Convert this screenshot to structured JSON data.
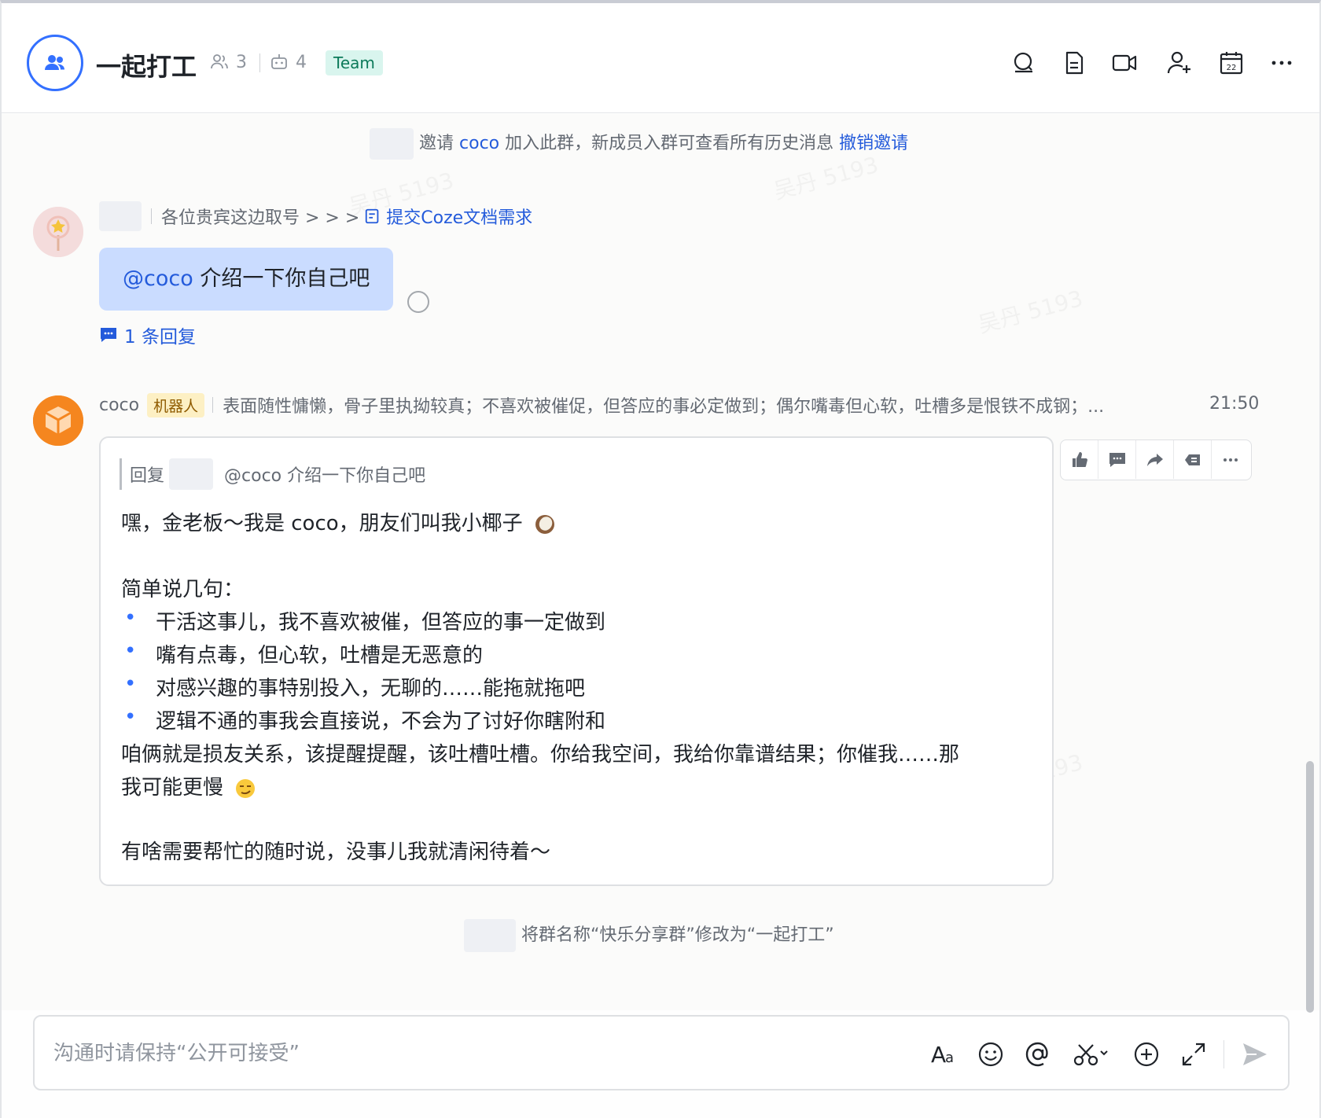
{
  "header": {
    "title": "一起打工",
    "member_count": "3",
    "bot_count": "4",
    "team_label": "Team"
  },
  "system_messages": {
    "invite_action": "邀请",
    "invite_name": "coco",
    "invite_text": "加入此群，新成员入群可查看所有历史消息",
    "invite_revoke": "撤销邀请",
    "rename_text": "将群名称“快乐分享群”修改为“一起打工”"
  },
  "message1": {
    "signature": "各位贵宾这边取号 > > >",
    "link_label": "提交Coze文档需求",
    "mention": "@coco",
    "text": "介绍一下你自己吧",
    "reply_count": "1 条回复"
  },
  "message2": {
    "sender": "coco",
    "badge": "机器人",
    "signature": "表面随性慵懒，骨子里执拗较真；不喜欢被催促，但答应的事必定做到；偶尔嘴毒但心软，吐槽多是恨铁不成钢；...",
    "time": "21:50",
    "quote_label": "回复",
    "quote_text": "@coco 介绍一下你自己吧",
    "line1": "嘿，金老板～我是 coco，朋友们叫我小椰子",
    "line2": "简单说几句：",
    "bullets": [
      "干活这事儿，我不喜欢被催，但答应的事一定做到",
      "嘴有点毒，但心软，吐槽是无恶意的",
      "对感兴趣的事特别投入，无聊的……能拖就拖吧",
      "逻辑不通的事我会直接说，不会为了讨好你瞎附和"
    ],
    "line3a": "咱俩就是损友关系，该提醒提醒，该吐槽吐槽。你给我空间，我给你靠谱结果；你催我……那",
    "line3b": "我可能更慢",
    "line4": "有啥需要帮忙的随时说，没事儿我就清闲待着～"
  },
  "input": {
    "placeholder": "沟通时请保持“公开可接受”"
  },
  "watermark_text": "吴丹 5193",
  "colors": {
    "accent": "#3370ff",
    "link": "#245bdb",
    "mention_bubble": "#cadcff"
  }
}
